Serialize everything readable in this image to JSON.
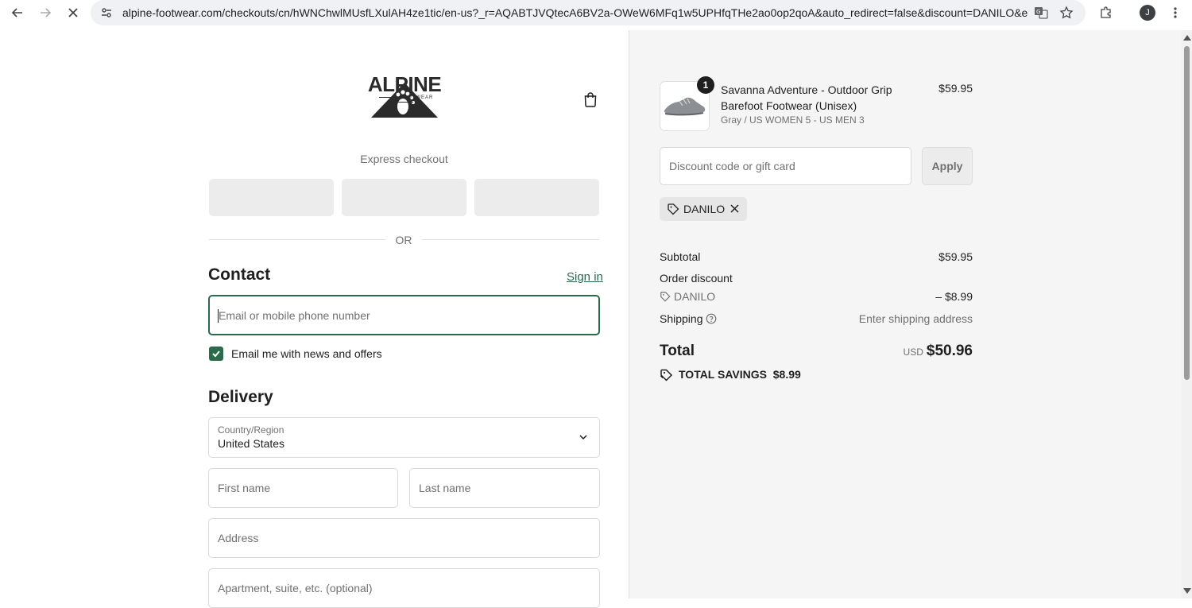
{
  "browser": {
    "url": "alpine-footwear.com/checkouts/cn/hWNChwlMUsfLXulAH4ze1tic/en-us?_r=AQABTJVQtecA6BV2a-OWeW6MFq1w5UPHfqTHe2ao0op2qoA&auto_redirect=false&discount=DANILO&edge...",
    "profile_initial": "J"
  },
  "brand": {
    "logo_word": "ALPINE",
    "logo_sub": "FOOTWEAR"
  },
  "express": {
    "label": "Express checkout",
    "or_text": "OR"
  },
  "contact": {
    "title": "Contact",
    "sign_in": "Sign in",
    "email_placeholder": "Email or mobile phone number",
    "news_label": "Email me with news and offers",
    "news_checked": true
  },
  "delivery": {
    "title": "Delivery",
    "country_label": "Country/Region",
    "country_value": "United States",
    "first_name_placeholder": "First name",
    "last_name_placeholder": "Last name",
    "address_placeholder": "Address",
    "apartment_placeholder": "Apartment, suite, etc. (optional)"
  },
  "summary": {
    "product": {
      "name": "Savanna Adventure - Outdoor Grip Barefoot Footwear (Unisex)",
      "variant": "Gray / US WOMEN 5 - US MEN 3",
      "price": "$59.95",
      "quantity": "1"
    },
    "discount_placeholder": "Discount code or gift card",
    "apply_label": "Apply",
    "applied_code": "DANILO",
    "subtotal_label": "Subtotal",
    "subtotal_value": "$59.95",
    "order_discount_label": "Order discount",
    "discount_code": "DANILO",
    "discount_value": "– $8.99",
    "shipping_label": "Shipping",
    "shipping_value": "Enter shipping address",
    "total_label": "Total",
    "total_currency": "USD",
    "total_value": "$50.96",
    "savings_label": "TOTAL SAVINGS",
    "savings_value": "$8.99"
  },
  "colors": {
    "accent": "#2b6a4a",
    "summary_bg": "#f5f5f5"
  }
}
